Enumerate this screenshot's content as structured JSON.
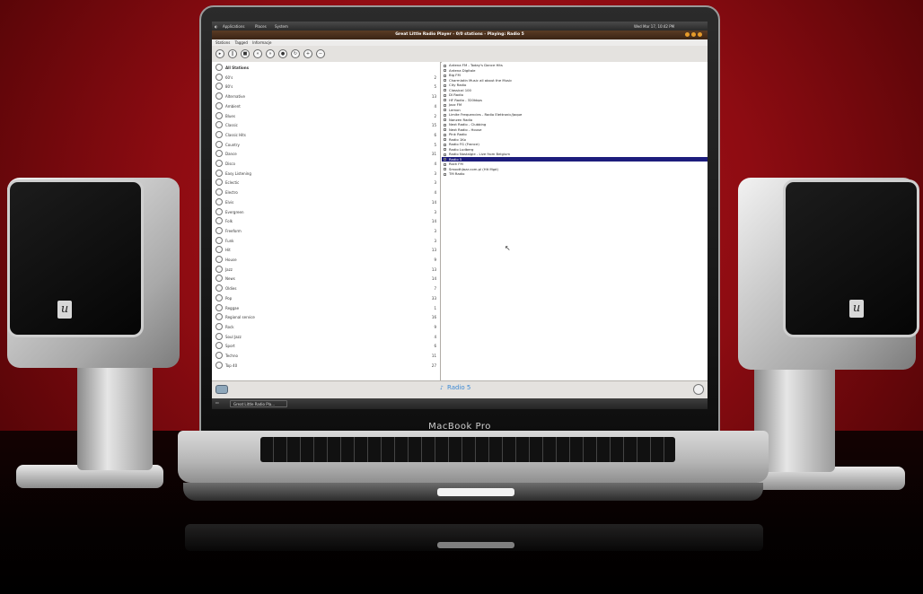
{
  "device": {
    "brand": "MacBook Pro"
  },
  "panel": {
    "applications": "Applications",
    "places": "Places",
    "system": "System",
    "clock": "Wed Mar 17, 10:42 PM"
  },
  "window": {
    "title": "Great Little Radio Player - 0/0 stations - Playing: Radio 5"
  },
  "menu": [
    "Stations",
    "Tagged",
    "Informacje"
  ],
  "toolbar_icons": [
    "play-icon",
    "pause-icon",
    "stop-icon",
    "previous-icon",
    "next-icon",
    "record-icon",
    "refresh-icon",
    "add-icon",
    "remove-icon"
  ],
  "genres": [
    {
      "name": "All Stations",
      "count": ""
    },
    {
      "name": "60's",
      "count": "2"
    },
    {
      "name": "80's",
      "count": "5"
    },
    {
      "name": "Alternative",
      "count": "13"
    },
    {
      "name": "Ambient",
      "count": "4"
    },
    {
      "name": "Blues",
      "count": "2"
    },
    {
      "name": "Classic",
      "count": "15"
    },
    {
      "name": "Classic Hits",
      "count": "6"
    },
    {
      "name": "Country",
      "count": "5"
    },
    {
      "name": "Dance",
      "count": "31"
    },
    {
      "name": "Disco",
      "count": "4"
    },
    {
      "name": "Easy Listening",
      "count": "3"
    },
    {
      "name": "Eclectic",
      "count": "3"
    },
    {
      "name": "Electro",
      "count": "4"
    },
    {
      "name": "Elvis",
      "count": "14"
    },
    {
      "name": "Evergreen",
      "count": "3"
    },
    {
      "name": "Folk",
      "count": "14"
    },
    {
      "name": "Freeform",
      "count": "3"
    },
    {
      "name": "Funk",
      "count": "3"
    },
    {
      "name": "Hit",
      "count": "13"
    },
    {
      "name": "House",
      "count": "9"
    },
    {
      "name": "Jazz",
      "count": "13"
    },
    {
      "name": "News",
      "count": "14"
    },
    {
      "name": "Oldies",
      "count": "7"
    },
    {
      "name": "Pop",
      "count": "33"
    },
    {
      "name": "Reggae",
      "count": "1"
    },
    {
      "name": "Regional service",
      "count": "16"
    },
    {
      "name": "Rock",
      "count": "9"
    },
    {
      "name": "Soul Jazz",
      "count": "4"
    },
    {
      "name": "Sport",
      "count": "6"
    },
    {
      "name": "Techno",
      "count": "11"
    },
    {
      "name": "Top 40",
      "count": "27"
    }
  ],
  "stations": [
    "Antena FM - Today's Dance Hits",
    "Antena Digitale",
    "Big FM",
    "Charmlatin Music all about the Music",
    "City Radio",
    "Classical 100",
    "DI Radio",
    "HF Radio - 320kbps",
    "Jazz FM",
    "Lemon",
    "Limite Frequencies - Radio Elettronic/Jaque",
    "Nanzen Radio",
    "Next Radio - Clubbing",
    "Next Radio - House",
    "Pink Radio",
    "Radio 1Ko",
    "Radio FG (France)",
    "Radio Ludberg",
    "Radio Nostalgie - Live from Belgium",
    "Radio 5",
    "Rock FM",
    "SmoothJazz.com.pl (Hit Mgd)",
    "TM Radio"
  ],
  "selected_station_index": 19,
  "now_playing": "Radio 5",
  "taskbar": {
    "item": "Great Little Radio Pla..."
  },
  "colors": {
    "background": "#9e0f16",
    "selection": "#1d1d7c",
    "now_playing": "#3d8ad4"
  }
}
